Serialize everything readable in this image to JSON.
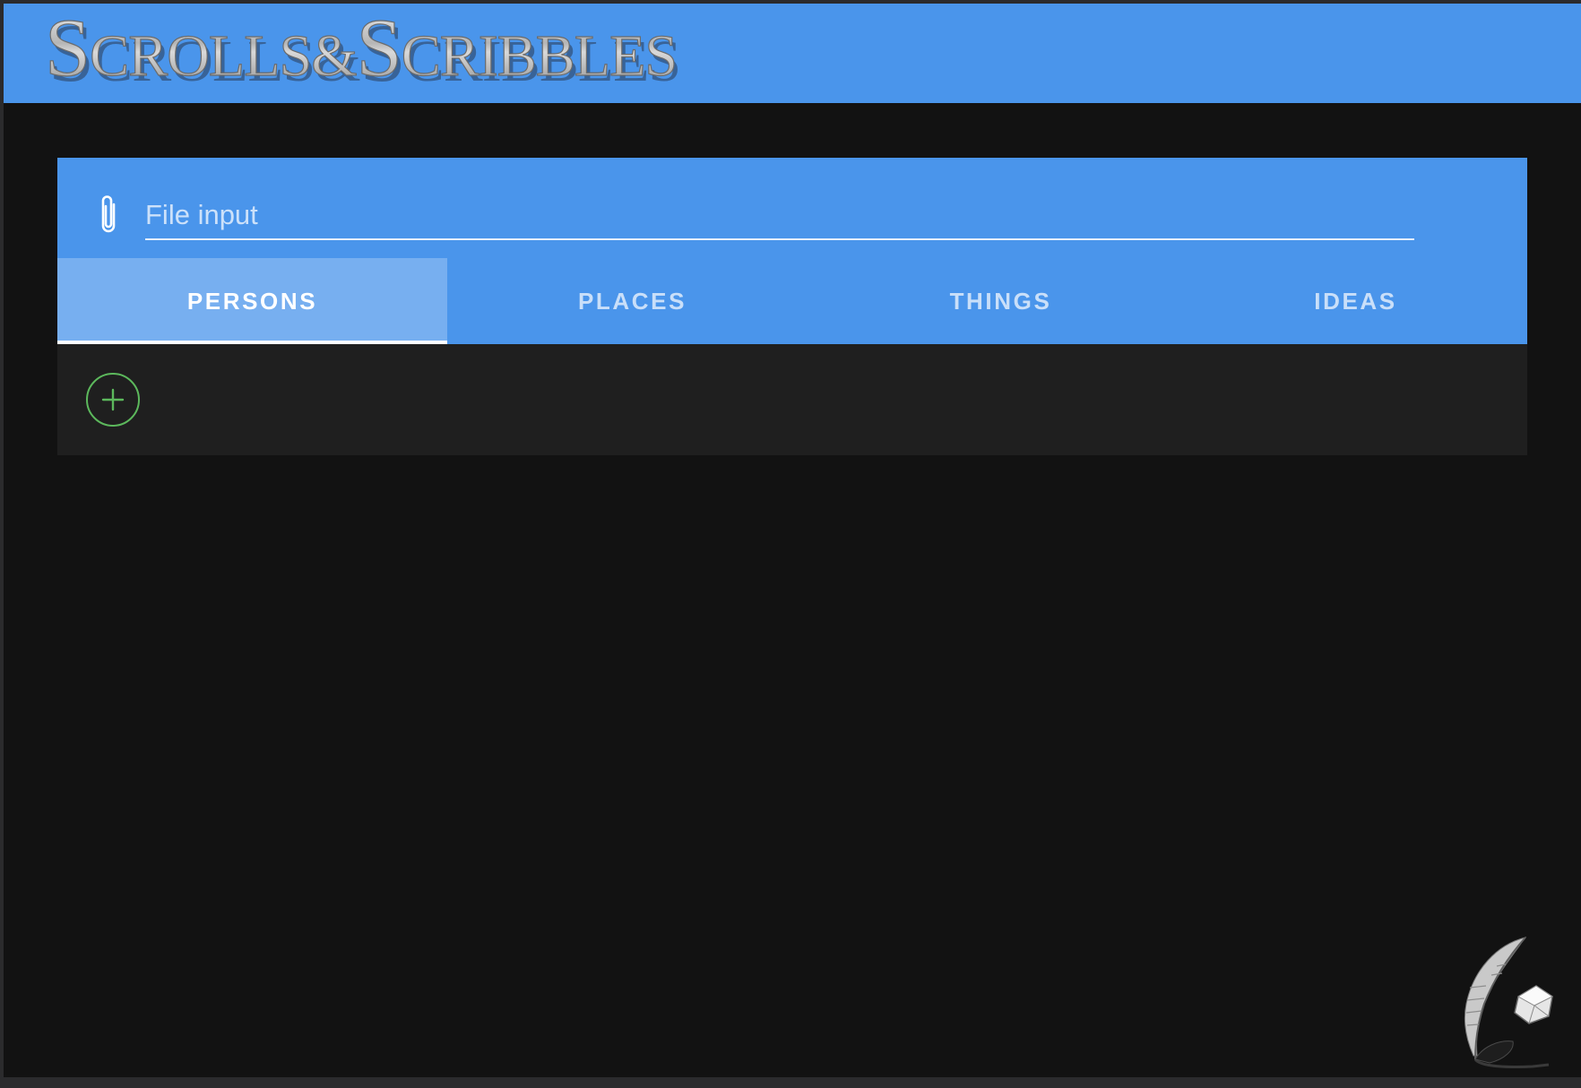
{
  "app": {
    "logo_text": "Scrolls&Scribbles",
    "accent_color": "#4a95eb",
    "background_color": "#121212"
  },
  "file_input": {
    "label": "File input",
    "icon": "paperclip-icon"
  },
  "tabs": [
    {
      "label": "PERSONS",
      "active": true
    },
    {
      "label": "PLACES",
      "active": false
    },
    {
      "label": "THINGS",
      "active": false
    },
    {
      "label": "IDEAS",
      "active": false
    }
  ],
  "add_button": {
    "icon": "plus-icon",
    "color": "#5cb85c"
  },
  "corner_logo": {
    "icon": "quill-inkwell-icon"
  }
}
